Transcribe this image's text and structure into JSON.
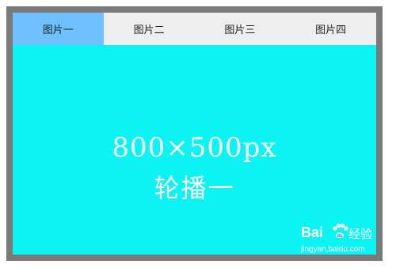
{
  "tabs": [
    {
      "label": "图片一",
      "active": true
    },
    {
      "label": "图片二",
      "active": false
    },
    {
      "label": "图片三",
      "active": false
    },
    {
      "label": "图片四",
      "active": false
    }
  ],
  "slide": {
    "size_text": "800×500px",
    "title": "轮播一",
    "background": "#0cf3f3"
  },
  "colors": {
    "active_tab": "#6fc0ff",
    "inactive_tab": "#eeeeee",
    "frame": "#7a7a7a"
  },
  "watermark": {
    "brand_left": "Bai",
    "brand_right": "经验",
    "url": "jingyan.baidu.com",
    "icon": "paw-icon"
  }
}
